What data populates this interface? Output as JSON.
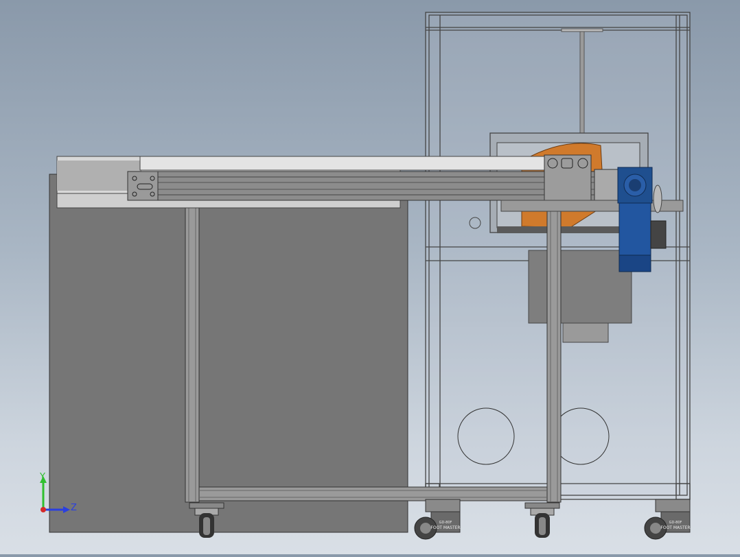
{
  "viewport": {
    "background_top": "#8a99aa",
    "background_bottom": "#d9dfe6"
  },
  "model": {
    "colors": {
      "sheet_panel": "#767676",
      "profile": "#8c8c8c",
      "profile_light": "#c8c8c8",
      "robot_orange": "#d07a2c",
      "motor_blue": "#1f4f8f",
      "outline": "#3a3a3a"
    }
  },
  "casters": {
    "brand": "FOOT MASTER",
    "model": "GD-80F"
  },
  "triad": {
    "y_label": "Y",
    "z_label": "Z",
    "y_color": "#2fbf2f",
    "z_color": "#2a3fe0",
    "x_color": "#d42a2a"
  }
}
